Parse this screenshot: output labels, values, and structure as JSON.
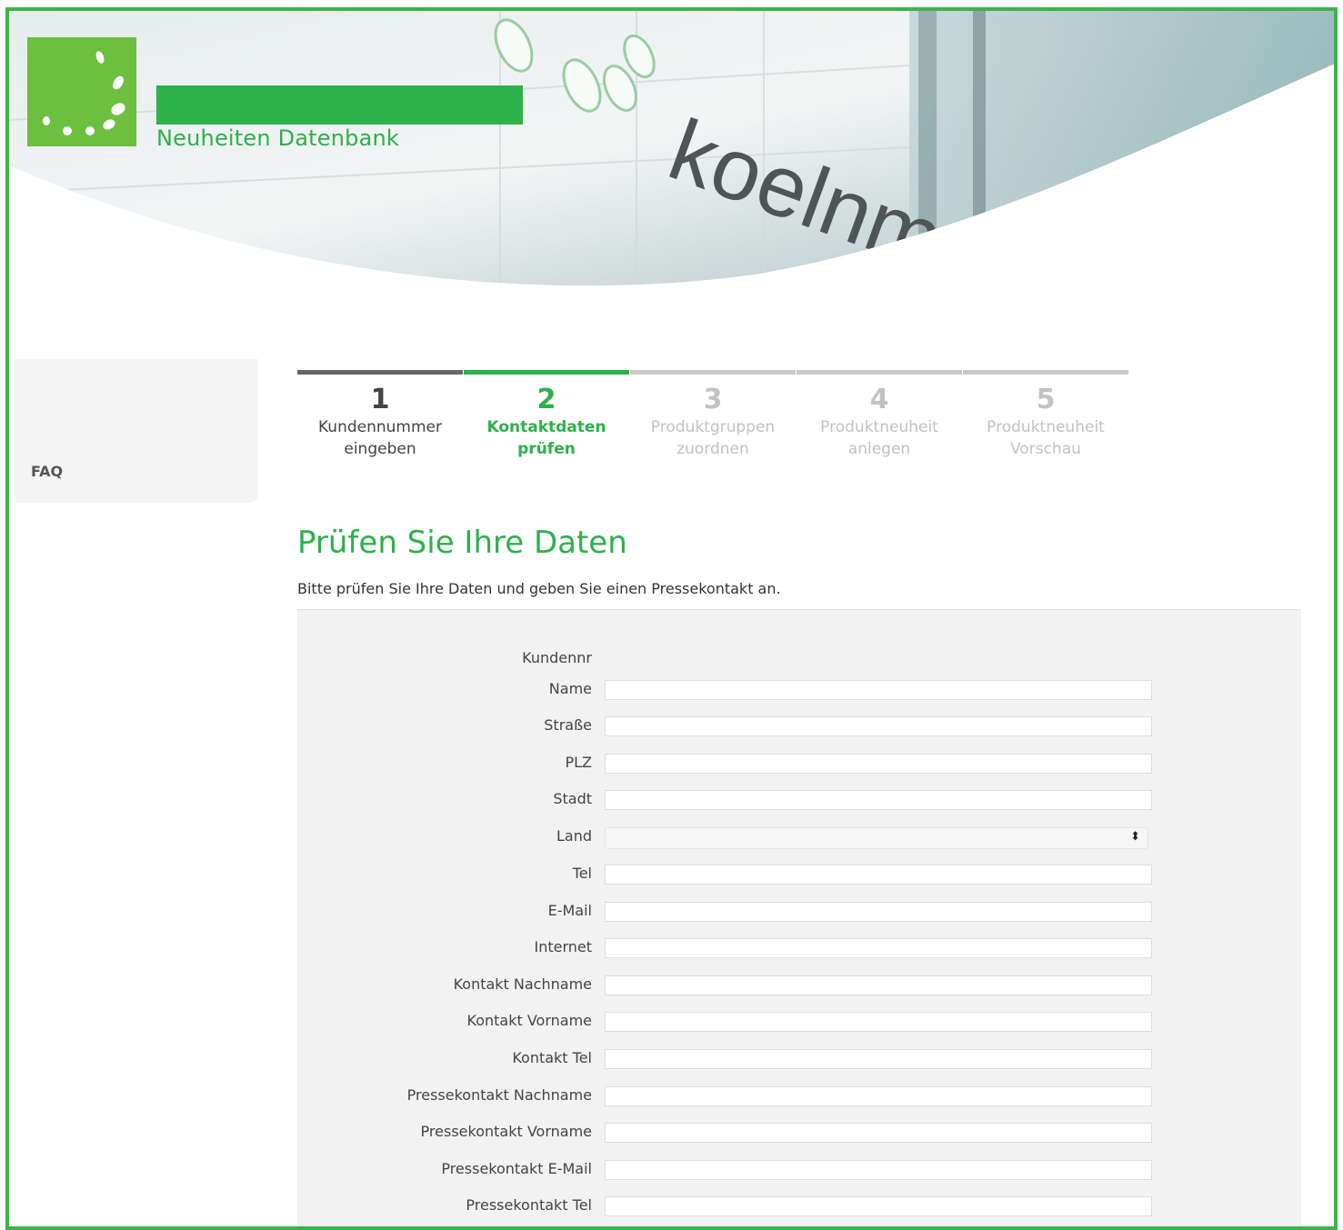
{
  "header": {
    "subtitle": "Neuheiten Datenbank",
    "building_sign": "koelnmesse",
    "brand_color": "#2eb04a",
    "logo_color": "#6cbf3f"
  },
  "sidebar": {
    "faq_label": "FAQ"
  },
  "steps": [
    {
      "num": "1",
      "line1": "Kundennummer",
      "line2": "eingeben",
      "state": "done"
    },
    {
      "num": "2",
      "line1": "Kontaktdaten",
      "line2": "prüfen",
      "state": "active"
    },
    {
      "num": "3",
      "line1": "Produktgruppen",
      "line2": "zuordnen",
      "state": "todo"
    },
    {
      "num": "4",
      "line1": "Produktneuheit",
      "line2": "anlegen",
      "state": "todo"
    },
    {
      "num": "5",
      "line1": "Produktneuheit",
      "line2": "Vorschau",
      "state": "todo"
    }
  ],
  "page": {
    "title": "Prüfen Sie Ihre Daten",
    "intro": "Bitte prüfen Sie Ihre Daten und geben Sie einen Pressekontakt an."
  },
  "form": {
    "kundennr_label": "Kundennr",
    "kundennr_value": "",
    "fields": [
      {
        "label": "Name",
        "value": ""
      },
      {
        "label": "Straße",
        "value": ""
      },
      {
        "label": "PLZ",
        "value": ""
      },
      {
        "label": "Stadt",
        "value": ""
      },
      {
        "label": "Land",
        "value": "",
        "type": "select"
      },
      {
        "label": "Tel",
        "value": ""
      },
      {
        "label": "E-Mail",
        "value": ""
      },
      {
        "label": "Internet",
        "value": ""
      },
      {
        "label": "Kontakt Nachname",
        "value": ""
      },
      {
        "label": "Kontakt Vorname",
        "value": ""
      },
      {
        "label": "Kontakt Tel",
        "value": ""
      },
      {
        "label": "Pressekontakt Nachname",
        "value": ""
      },
      {
        "label": "Pressekontakt Vorname",
        "value": ""
      },
      {
        "label": "Pressekontakt E-Mail",
        "value": ""
      },
      {
        "label": "Pressekontakt Tel",
        "value": ""
      }
    ],
    "select_arrow": "⬍"
  }
}
